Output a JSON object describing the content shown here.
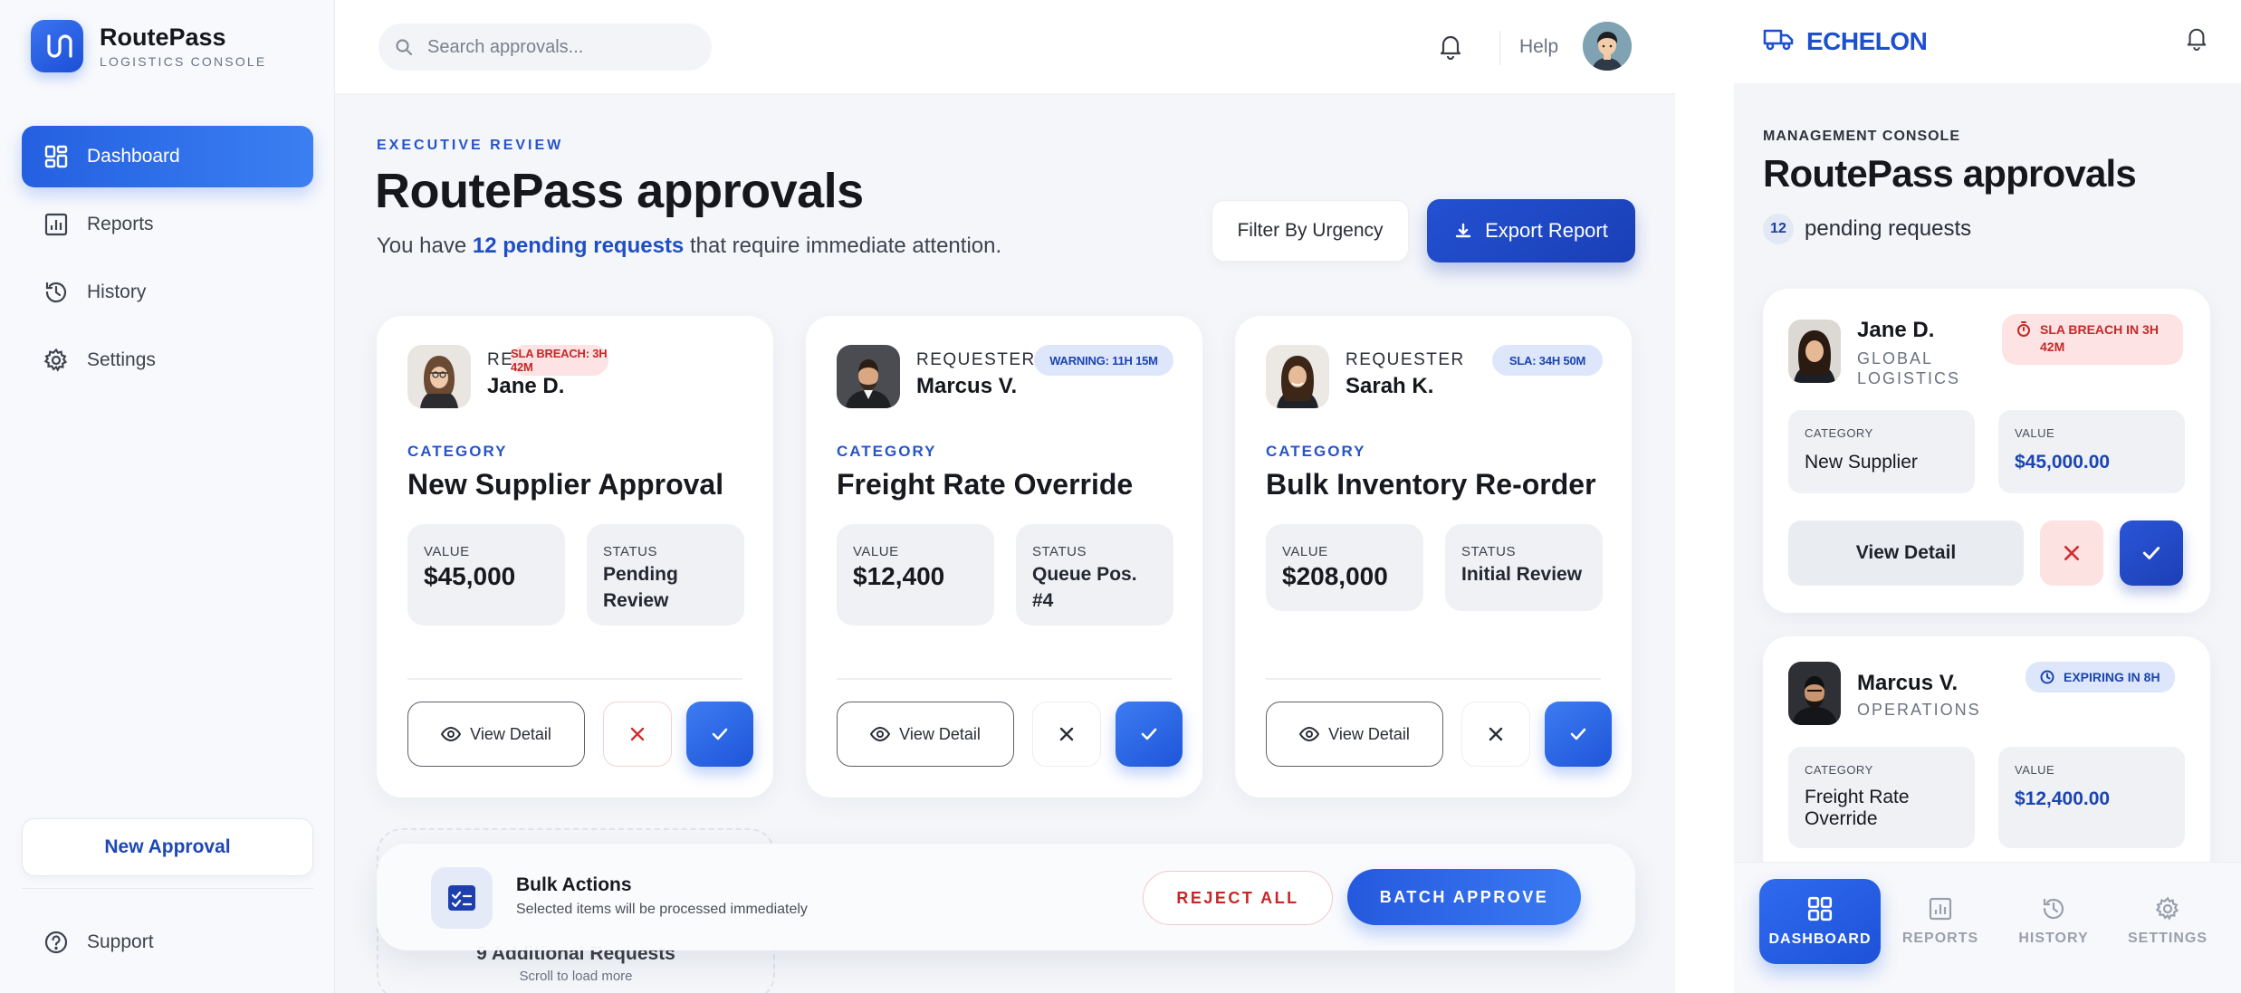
{
  "app": {
    "name": "RoutePass",
    "subtitle": "LOGISTICS CONSOLE"
  },
  "sidebar": {
    "items": [
      {
        "label": "Dashboard",
        "icon": "dashboard-icon",
        "active": true
      },
      {
        "label": "Reports",
        "icon": "reports-icon"
      },
      {
        "label": "History",
        "icon": "history-icon"
      },
      {
        "label": "Settings",
        "icon": "settings-icon"
      }
    ],
    "new_approval": "New Approval",
    "support": "Support"
  },
  "topbar": {
    "search_placeholder": "Search approvals...",
    "help": "Help"
  },
  "header": {
    "eyebrow": "EXECUTIVE REVIEW",
    "title": "RoutePass approvals",
    "lead_pre": "You have ",
    "lead_count": "12 pending requests",
    "lead_post": " that require immediate attention.",
    "filter_button": "Filter By Urgency",
    "export_button": "Export Report"
  },
  "cards": [
    {
      "requester_label": "REQUESTER",
      "requester": "Jane D.",
      "badge": "SLA BREACH: 3H 42M",
      "category_label": "CATEGORY",
      "category": "New Supplier Approval",
      "value_label": "VALUE",
      "value": "$45,000",
      "status_label": "STATUS",
      "status": "Pending Review",
      "view_detail": "View Detail"
    },
    {
      "requester_label": "REQUESTER",
      "requester": "Marcus V.",
      "badge": "WARNING: 11H 15M",
      "category_label": "CATEGORY",
      "category": "Freight Rate Override",
      "value_label": "VALUE",
      "value": "$12,400",
      "status_label": "STATUS",
      "status": "Queue Pos. #4",
      "view_detail": "View Detail"
    },
    {
      "requester_label": "REQUESTER",
      "requester": "Sarah K.",
      "badge": "SLA: 34H 50M",
      "category_label": "CATEGORY",
      "category": "Bulk Inventory Re-order",
      "value_label": "VALUE",
      "value": "$208,000",
      "status_label": "STATUS",
      "status": "Initial Review",
      "view_detail": "View Detail"
    }
  ],
  "more": {
    "title": "9 Additional Requests",
    "subtitle": "Scroll to load more"
  },
  "bulk": {
    "title": "Bulk Actions",
    "subtitle": "Selected items will be processed immediately",
    "reject_all": "REJECT ALL",
    "batch_approve": "BATCH APPROVE"
  },
  "mobile": {
    "brand": "ECHELON",
    "eyebrow": "MANAGEMENT CONSOLE",
    "title": "RoutePass approvals",
    "count": "12",
    "pending": "pending requests",
    "cards": [
      {
        "name": "Jane D.",
        "dept_1": "GLOBAL",
        "dept_2": "LOGISTICS",
        "badge_1": "SLA BREACH IN 3H",
        "badge_2": "42M",
        "category_label": "CATEGORY",
        "category": "New Supplier",
        "value_label": "VALUE",
        "value": "$45,000.00",
        "view_detail": "View Detail"
      },
      {
        "name": "Marcus V.",
        "dept": "OPERATIONS",
        "badge": "EXPIRING IN 8H",
        "category_label": "CATEGORY",
        "category_1": "Freight Rate",
        "category_2": "Override",
        "value_label": "VALUE",
        "value": "$12,400.00"
      }
    ],
    "tabs": [
      "DASHBOARD",
      "REPORTS",
      "HISTORY",
      "SETTINGS"
    ]
  },
  "colors": {
    "accent": "#2563EB",
    "accent_dark": "#1E40AF",
    "danger": "#C62828",
    "background": "#F4F6FA"
  }
}
